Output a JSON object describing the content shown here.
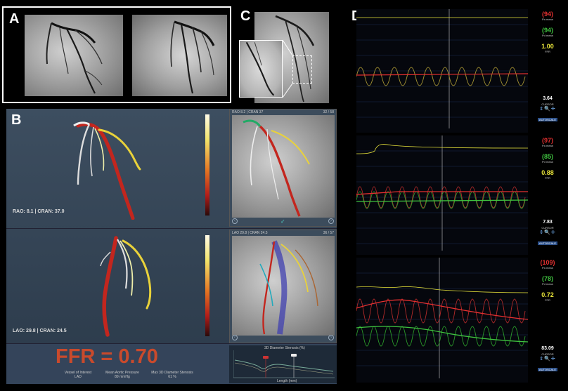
{
  "panels": {
    "a": {
      "letter": "A"
    },
    "b": {
      "letter": "B",
      "view1": {
        "label": "RAO: 8.1  |  CRAN: 37.0",
        "header_left": "RAO 8.2 | CRAN 37",
        "header_right": "32 / 58"
      },
      "view2": {
        "label": "LAO: 29.8  |  CRAN: 24.5",
        "header_left": "LAO 29.8 | CRAN 24.5",
        "header_right": "36 / 57"
      },
      "ffr_text": "FFR = 0.70",
      "stats": [
        {
          "label": "Vessel of Interest",
          "value": "LAD"
        },
        {
          "label": "Mean Aortic Pressure",
          "value": "89 mmHg"
        },
        {
          "label": "Max 3D Diameter Stenosis",
          "value": "61 %"
        }
      ],
      "profile": {
        "title": "3D Diameter Stenosis (%)",
        "ylabel": "Diameter (mm)",
        "xlabel": "Length (mm)"
      }
    },
    "c": {
      "letter": "C"
    },
    "d": {
      "letter": "D",
      "rows": [
        {
          "pa_value": "(94)",
          "pa_label": "Pa mean",
          "pd_value": "(94)",
          "pd_label": "Pd mean",
          "ffr_value": "1.00",
          "ffr_label": "FFR",
          "cursor_value": "3.64",
          "cursor_label": "CURSOR",
          "autoscale": "AUTOSCALE"
        },
        {
          "pa_value": "(97)",
          "pa_label": "Pa mean",
          "pd_value": "(85)",
          "pd_label": "Pd mean",
          "ffr_value": "0.88",
          "ffr_label": "FFR",
          "cursor_value": "7.83",
          "cursor_label": "CURSOR",
          "autoscale": "AUTOSCALE"
        },
        {
          "pa_value": "(109)",
          "pa_label": "Pa mean",
          "pd_value": "(78)",
          "pd_label": "Pd mean",
          "ffr_value": "0.72",
          "ffr_label": "FFR",
          "cursor_value": "83.09",
          "cursor_label": "CURSOR",
          "autoscale": "AUTOSCALE"
        }
      ]
    }
  },
  "colors": {
    "pa": "#e53030",
    "pd": "#3fc23f",
    "ffr": "#e8e43a",
    "ffr_big": "#c94a2c"
  }
}
